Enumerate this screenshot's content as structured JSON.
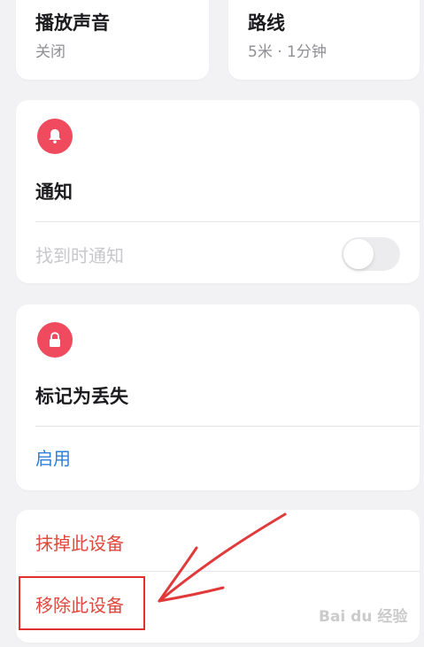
{
  "play_sound": {
    "title": "播放声音",
    "status": "关闭"
  },
  "route": {
    "title": "路线",
    "detail": "5米 · 1分钟"
  },
  "notify": {
    "title": "通知",
    "found_label": "找到时通知",
    "toggle_on": false
  },
  "lost": {
    "title": "标记为丢失",
    "enable_label": "启用"
  },
  "actions": {
    "erase_label": "抹掉此设备",
    "remove_label": "移除此设备"
  },
  "colors": {
    "accent_red": "#ef4a5e",
    "link_blue": "#2f7fd8",
    "destructive": "#e0483d"
  },
  "icons": {
    "notify_icon": "bell-icon",
    "lost_icon": "lock-icon"
  },
  "watermark": {
    "text": "Bai du 经验"
  }
}
